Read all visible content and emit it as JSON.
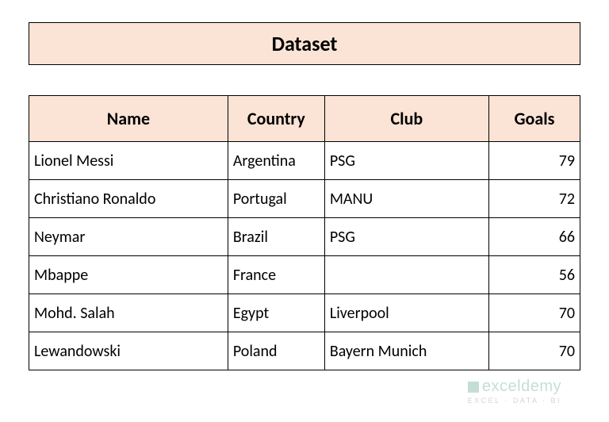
{
  "title": "Dataset",
  "headers": {
    "name": "Name",
    "country": "Country",
    "club": "Club",
    "goals": "Goals"
  },
  "rows": [
    {
      "name": "Lionel Messi",
      "country": "Argentina",
      "club": "PSG",
      "goals": "79"
    },
    {
      "name": "Christiano Ronaldo",
      "country": "Portugal",
      "club": "MANU",
      "goals": "72"
    },
    {
      "name": "Neymar",
      "country": "Brazil",
      "club": "PSG",
      "goals": "66"
    },
    {
      "name": "Mbappe",
      "country": "France",
      "club": "",
      "goals": "56"
    },
    {
      "name": "Mohd. Salah",
      "country": "Egypt",
      "club": "Liverpool",
      "goals": "70"
    },
    {
      "name": "Lewandowski",
      "country": "Poland",
      "club": "Bayern Munich",
      "goals": "70"
    }
  ],
  "watermark": {
    "brand": "exceldemy",
    "tag": "EXCEL · DATA · BI"
  },
  "chart_data": {
    "type": "table",
    "title": "Dataset",
    "columns": [
      "Name",
      "Country",
      "Club",
      "Goals"
    ],
    "rows": [
      [
        "Lionel Messi",
        "Argentina",
        "PSG",
        79
      ],
      [
        "Christiano Ronaldo",
        "Portugal",
        "MANU",
        72
      ],
      [
        "Neymar",
        "Brazil",
        "PSG",
        66
      ],
      [
        "Mbappe",
        "France",
        "",
        56
      ],
      [
        "Mohd. Salah",
        "Egypt",
        "Liverpool",
        70
      ],
      [
        "Lewandowski",
        "Poland",
        "Bayern Munich",
        70
      ]
    ]
  }
}
